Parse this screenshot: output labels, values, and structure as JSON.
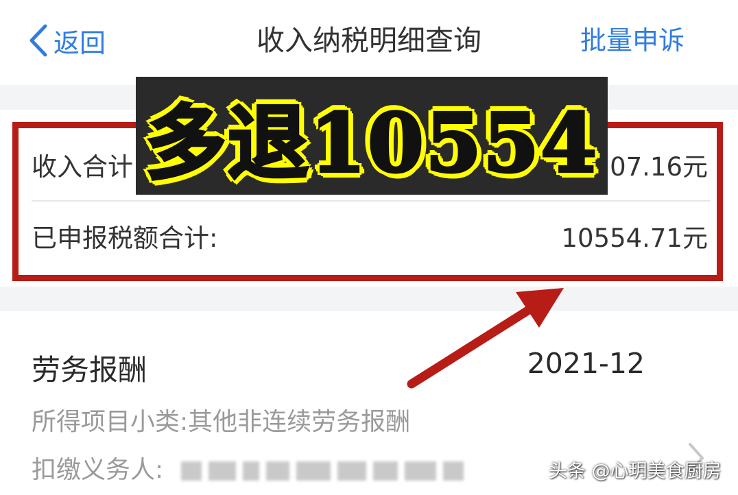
{
  "nav": {
    "back_label": "返回",
    "title": "收入纳税明细查询",
    "batch_label": "批量申诉"
  },
  "summary": {
    "income_label": "收入合计",
    "income_value": "07.16元",
    "tax_label": "已申报税额合计:",
    "tax_value": "10554.71元"
  },
  "record": {
    "title": "劳务报酬",
    "period": "2021-12",
    "subcategory_line": "所得项目小类:其他非连续劳务报酬",
    "withholder_label": "扣缴义务人:"
  },
  "overlay": {
    "banner_text": "多退10554"
  },
  "watermark": {
    "text": "头条 @心玥美食厨房"
  },
  "colors": {
    "link_blue": "#2f7de1",
    "highlight_red": "#b81c16",
    "banner_yellow": "#ffff00"
  }
}
